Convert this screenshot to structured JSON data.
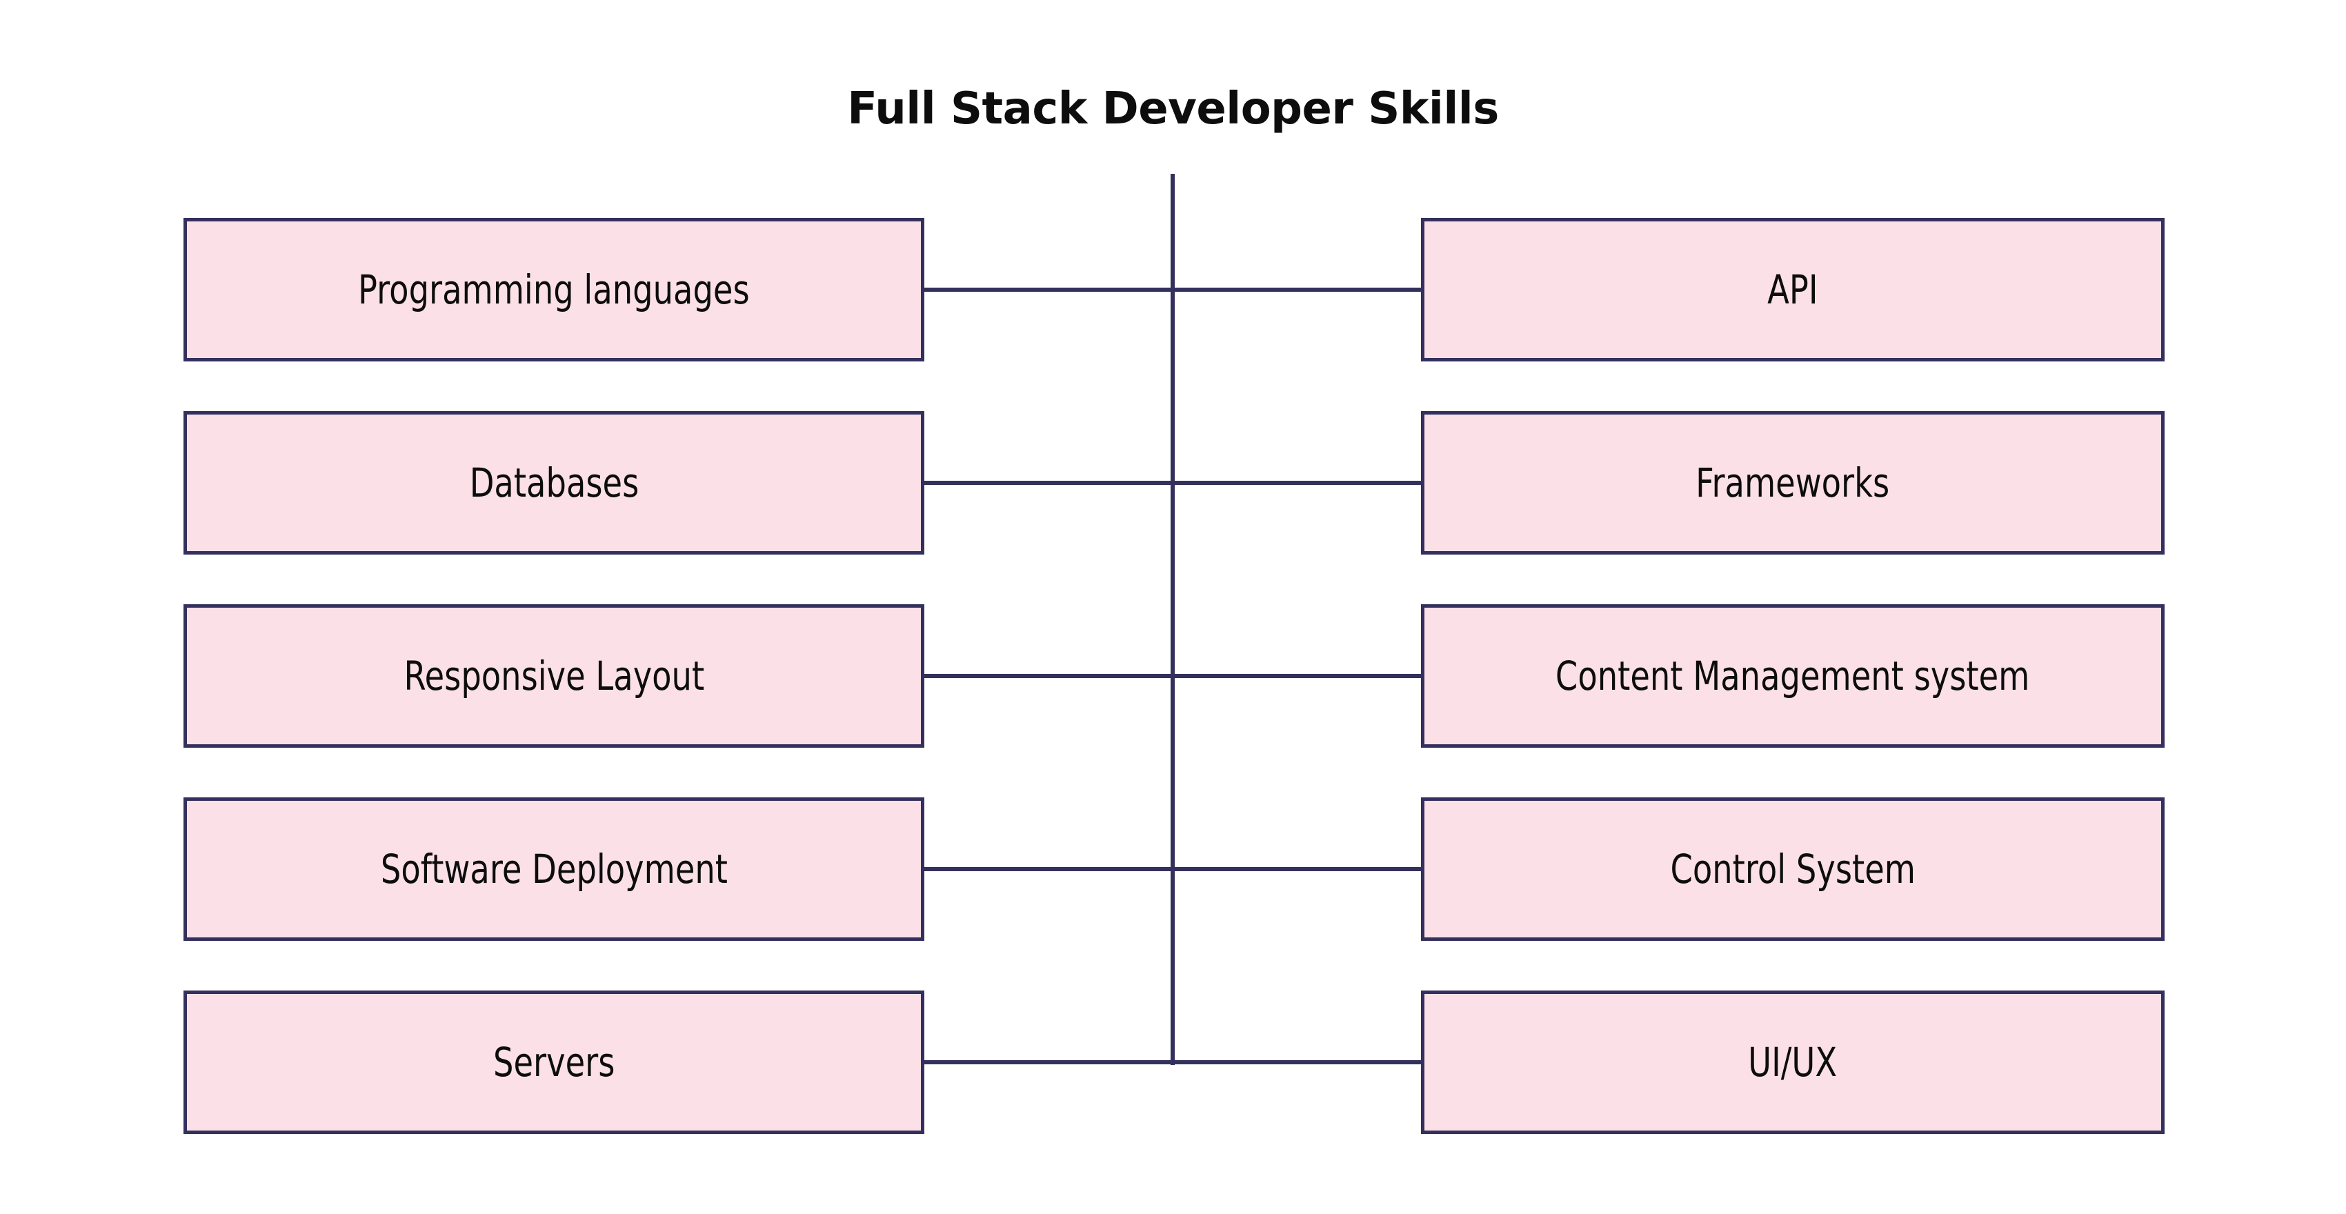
{
  "diagram": {
    "title": "Full Stack Developer Skills",
    "type": "two-column-comparison",
    "colors": {
      "box_fill": "#fbe0e8",
      "box_border": "#33305e",
      "connector": "#33305e",
      "title_text": "#0d0d0d",
      "label_text": "#0d0d0d",
      "background": "#ffffff"
    },
    "rows": [
      {
        "left": "Programming languages",
        "right": "API"
      },
      {
        "left": "Databases",
        "right": "Frameworks"
      },
      {
        "left": "Responsive Layout",
        "right": "Content Management system"
      },
      {
        "left": "Software Deployment",
        "right": "Control System"
      },
      {
        "left": "Servers",
        "right": "UI/UX"
      }
    ]
  }
}
